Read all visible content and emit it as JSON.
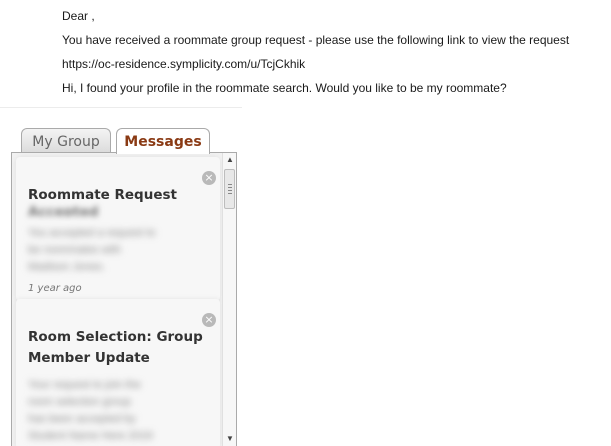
{
  "email": {
    "greeting": "Dear ,",
    "line1": "You have received a roommate group request - please use the following link to view the request",
    "link": "https://oc-residence.symplicity.com/u/TcjCkhik",
    "line2": "Hi, I found your profile in the roommate search. Would you like to be my roommate?"
  },
  "tabs": {
    "group": "My Group",
    "messages": "Messages"
  },
  "messages": [
    {
      "title_line1": "Roommate Request",
      "title_line2": "Accepted",
      "body": [
        "You accepted a request to",
        "be roommates with",
        "Madison Jones."
      ],
      "time": "1 year ago"
    },
    {
      "title_line1": "Room Selection: Group",
      "title_line2": "Member Update",
      "body": [
        "Your request to join the",
        "room selection group",
        "has been accepted by",
        "Student Name Here 2019"
      ]
    }
  ],
  "icons": {
    "close": "×",
    "scroll_up": "▲",
    "scroll_down": "▼"
  }
}
